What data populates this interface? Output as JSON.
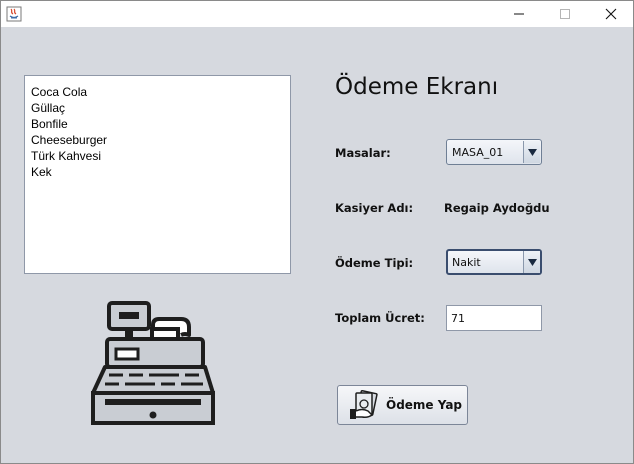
{
  "window": {
    "title": "",
    "controls": {
      "minimize": "minimize-icon",
      "maximize": "maximize-icon",
      "close": "close-icon"
    }
  },
  "order_list": {
    "items": [
      "Coca Cola",
      "Güllaç",
      "Bonfile",
      "Cheeseburger",
      "Türk Kahvesi",
      "Kek"
    ]
  },
  "form": {
    "title": "Ödeme Ekranı",
    "masalar_label": "Masalar:",
    "masalar_value": "MASA_01",
    "kasiyer_label": "Kasiyer Adı:",
    "kasiyer_value": "Regaip Aydoğdu",
    "odeme_tipi_label": "Ödeme Tipi:",
    "odeme_tipi_value": "Nakit",
    "toplam_label": "Toplam Ücret:",
    "toplam_value": "71",
    "pay_button_label": "Ödeme Yap"
  },
  "colors": {
    "background": "#d6d9df",
    "text": "#111111",
    "icon_dark": "#1e1e1e",
    "icon_body": "#c9cdd3"
  }
}
